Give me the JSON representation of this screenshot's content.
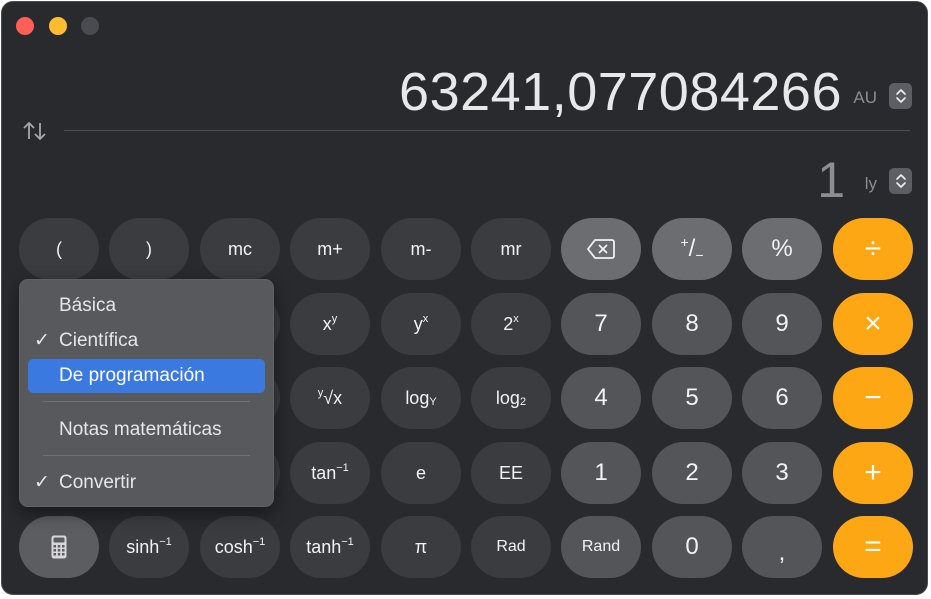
{
  "window": {
    "traffic_lights": [
      "close",
      "minimize",
      "zoom"
    ]
  },
  "display": {
    "primary_value": "63241,077084266",
    "primary_unit": "AU",
    "secondary_value": "1",
    "secondary_unit": "ly",
    "swap_icon": "swap-arrows-icon",
    "stepper_icon": "chevron-up-down-icon"
  },
  "keypad": {
    "rows": [
      [
        "(",
        ")",
        "mc",
        "m+",
        "m-",
        "mr",
        "backspace",
        "+/-",
        "%",
        "÷"
      ],
      [
        "",
        "",
        "",
        "xʸ",
        "yˣ",
        "2ˣ",
        "7",
        "8",
        "9",
        "×"
      ],
      [
        "",
        "",
        "",
        "ʸ√x",
        "logᵧ",
        "log₂",
        "4",
        "5",
        "6",
        "−"
      ],
      [
        "",
        "",
        "",
        "tan⁻¹",
        "e",
        "EE",
        "1",
        "2",
        "3",
        "+"
      ],
      [
        "calculator",
        "sinh⁻¹",
        "cosh⁻¹",
        "tanh⁻¹",
        "π",
        "Rad",
        "Rand",
        "0",
        ",",
        "="
      ]
    ],
    "labels": {
      "paren_open": "(",
      "paren_close": ")",
      "mc": "mc",
      "m_plus": "m+",
      "m_minus": "m-",
      "mr": "mr",
      "plus_minus_top": "+",
      "plus_minus_slash": "/",
      "plus_minus_bottom": "−",
      "percent": "%",
      "divide": "÷",
      "x_pow_y_base": "x",
      "x_pow_y_exp": "y",
      "y_pow_x_base": "y",
      "y_pow_x_exp": "x",
      "two_pow_x_base": "2",
      "two_pow_x_exp": "x",
      "seven": "7",
      "eight": "8",
      "nine": "9",
      "multiply": "×",
      "root_index": "y",
      "root_body": "√x",
      "log_y_base": "log",
      "log_y_sub": "Y",
      "log2_base": "log",
      "log2_sub": "2",
      "four": "4",
      "five": "5",
      "six": "6",
      "minus": "−",
      "atan_base": "tan",
      "atan_exp": "−1",
      "e": "e",
      "ee": "EE",
      "one": "1",
      "two": "2",
      "three": "3",
      "plus": "+",
      "asinh_base": "sinh",
      "asinh_exp": "−1",
      "acosh_base": "cosh",
      "acosh_exp": "−1",
      "atanh_base": "tanh",
      "atanh_exp": "−1",
      "pi": "π",
      "rad": "Rad",
      "rand": "Rand",
      "zero": "0",
      "decimal": ",",
      "equals": "="
    }
  },
  "mode_menu": {
    "items": [
      {
        "label": "Básica",
        "checked": false,
        "highlighted": false
      },
      {
        "label": "Científica",
        "checked": true,
        "highlighted": false
      },
      {
        "label": "De programación",
        "checked": false,
        "highlighted": true
      },
      {
        "label": "Notas matemáticas",
        "checked": false,
        "highlighted": false
      },
      {
        "label": "Convertir",
        "checked": true,
        "highlighted": false
      }
    ],
    "check_glyph": "✓"
  },
  "colors": {
    "background": "#292a2e",
    "operator": "#fea714",
    "digit": "#545559",
    "function": "#3b3c40",
    "top_row": "#6c6d71",
    "menu_highlight": "#3a7ae0"
  }
}
